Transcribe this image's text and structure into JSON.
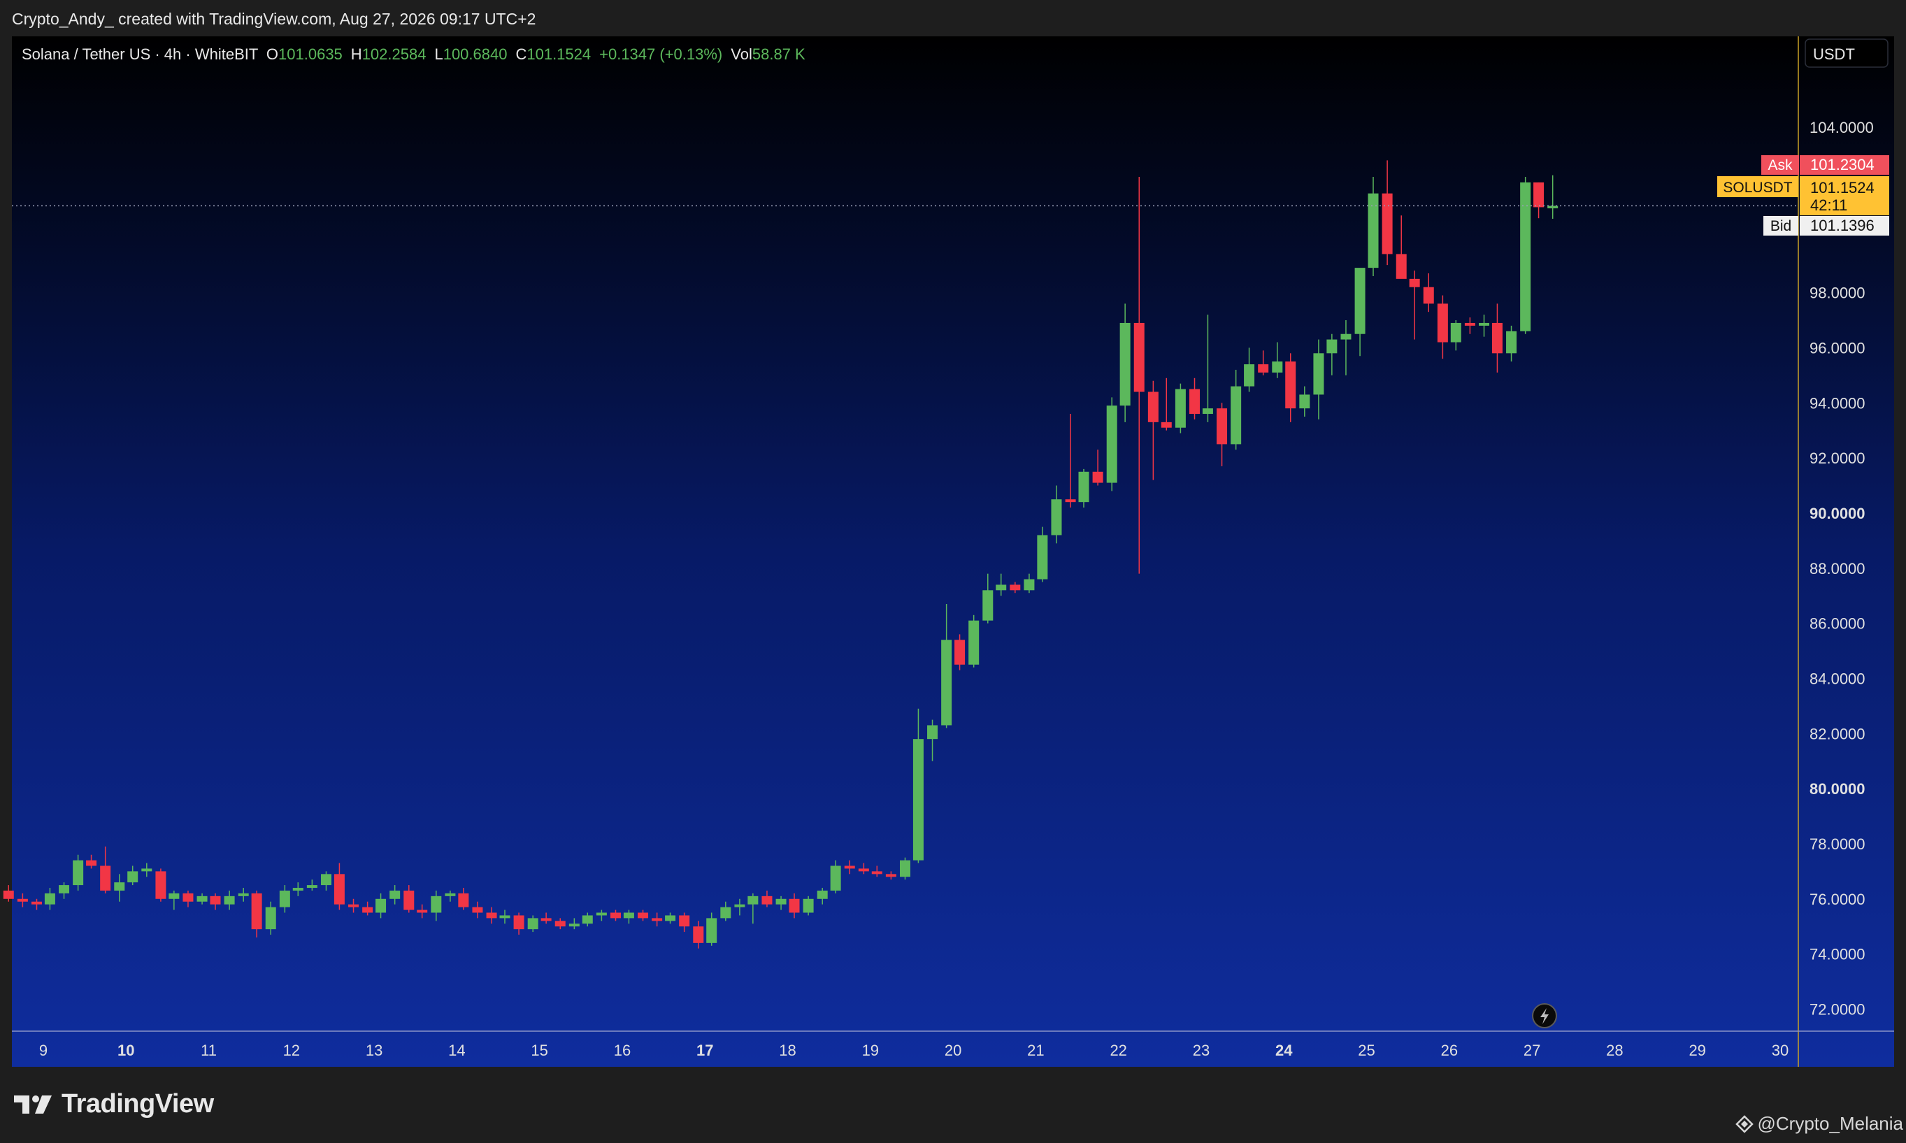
{
  "header": {
    "caption": "Crypto_Andy_ created with TradingView.com, Aug 27, 2026 09:17 UTC+2"
  },
  "legend": {
    "symbol_label": "Solana / Tether US · 4h · WhiteBIT",
    "open_label": "O",
    "open_value": "101.0635",
    "high_label": "H",
    "high_value": "102.2584",
    "low_label": "L",
    "low_value": "100.6840",
    "close_label": "C",
    "close_value": "101.1524",
    "change": "+0.1347 (+0.13%)",
    "vol_label": "Vol",
    "vol_value": "58.87 K"
  },
  "price_scale": {
    "currency": "USDT",
    "ask_label": "Ask",
    "ask_value": "101.2304",
    "symbol_tag": "SOLUSDT",
    "last_value": "101.1524",
    "countdown": "42:11",
    "bid_label": "Bid",
    "bid_value": "101.1396"
  },
  "footer": {
    "brand": "TradingView",
    "watermark": "@Crypto_Melania"
  },
  "colors": {
    "up": "#5cb85c",
    "down": "#f23645",
    "bg_top": "#000000",
    "bg_bottom": "#0f2d9e",
    "ask": "#f0505c",
    "last": "#ffc233",
    "bid": "#f0f0f0"
  },
  "icons": {
    "brand": "tradingview-logo-icon",
    "watermark": "diamond-icon",
    "flash": "lightning-icon"
  },
  "chart_data": {
    "type": "candlestick",
    "interval": "4h",
    "y_ticks": [
      72,
      74,
      76,
      78,
      80,
      82,
      84,
      86,
      88,
      90,
      92,
      94,
      96,
      98,
      100,
      102,
      104
    ],
    "y_tick_labels": [
      "72.0000",
      "74.0000",
      "76.0000",
      "78.0000",
      "80.0000",
      "82.0000",
      "84.0000",
      "86.0000",
      "88.0000",
      "90.0000",
      "92.0000",
      "94.0000",
      "96.0000",
      "98.0000",
      "",
      "",
      "104.0000"
    ],
    "ylim": [
      71.2,
      107.3
    ],
    "x_ticks": [
      9,
      10,
      11,
      12,
      13,
      14,
      15,
      16,
      17,
      18,
      19,
      20,
      21,
      22,
      23,
      24,
      25,
      26,
      27,
      28,
      29,
      30
    ],
    "x_tick_labels": [
      "9",
      "10",
      "11",
      "12",
      "13",
      "14",
      "15",
      "16",
      "17",
      "18",
      "19",
      "20",
      "21",
      "22",
      "23",
      "24",
      "25",
      "26",
      "27",
      "28",
      "29",
      "30"
    ],
    "x_bold_labels": [
      "10",
      "17",
      "24"
    ],
    "xlim": [
      8.62,
      30.22
    ],
    "last_price": 101.1524,
    "candles": [
      {
        "t": 8.58,
        "o": 76.3,
        "h": 76.5,
        "l": 75.9,
        "c": 76.0
      },
      {
        "t": 8.75,
        "o": 76.0,
        "h": 76.2,
        "l": 75.7,
        "c": 75.9
      },
      {
        "t": 8.92,
        "o": 75.9,
        "h": 76.0,
        "l": 75.6,
        "c": 75.8
      },
      {
        "t": 9.08,
        "o": 75.8,
        "h": 76.4,
        "l": 75.6,
        "c": 76.2
      },
      {
        "t": 9.25,
        "o": 76.2,
        "h": 76.6,
        "l": 76.0,
        "c": 76.5
      },
      {
        "t": 9.42,
        "o": 76.5,
        "h": 77.6,
        "l": 76.3,
        "c": 77.4
      },
      {
        "t": 9.58,
        "o": 77.4,
        "h": 77.6,
        "l": 77.1,
        "c": 77.2
      },
      {
        "t": 9.75,
        "o": 77.2,
        "h": 77.9,
        "l": 76.2,
        "c": 76.3
      },
      {
        "t": 9.92,
        "o": 76.3,
        "h": 76.9,
        "l": 75.9,
        "c": 76.6
      },
      {
        "t": 10.08,
        "o": 76.6,
        "h": 77.2,
        "l": 76.5,
        "c": 77.0
      },
      {
        "t": 10.25,
        "o": 77.0,
        "h": 77.3,
        "l": 76.8,
        "c": 77.1
      },
      {
        "t": 10.42,
        "o": 77.0,
        "h": 77.1,
        "l": 75.9,
        "c": 76.0
      },
      {
        "t": 10.58,
        "o": 76.0,
        "h": 76.3,
        "l": 75.6,
        "c": 76.2
      },
      {
        "t": 10.75,
        "o": 76.2,
        "h": 76.3,
        "l": 75.7,
        "c": 75.9
      },
      {
        "t": 10.92,
        "o": 75.9,
        "h": 76.2,
        "l": 75.8,
        "c": 76.1
      },
      {
        "t": 11.08,
        "o": 76.1,
        "h": 76.2,
        "l": 75.6,
        "c": 75.8
      },
      {
        "t": 11.25,
        "o": 75.8,
        "h": 76.3,
        "l": 75.6,
        "c": 76.1
      },
      {
        "t": 11.42,
        "o": 76.1,
        "h": 76.4,
        "l": 75.9,
        "c": 76.2
      },
      {
        "t": 11.58,
        "o": 76.2,
        "h": 76.3,
        "l": 74.6,
        "c": 74.9
      },
      {
        "t": 11.75,
        "o": 74.9,
        "h": 75.9,
        "l": 74.7,
        "c": 75.7
      },
      {
        "t": 11.92,
        "o": 75.7,
        "h": 76.5,
        "l": 75.5,
        "c": 76.3
      },
      {
        "t": 12.08,
        "o": 76.3,
        "h": 76.6,
        "l": 76.1,
        "c": 76.4
      },
      {
        "t": 12.25,
        "o": 76.4,
        "h": 76.7,
        "l": 76.3,
        "c": 76.5
      },
      {
        "t": 12.42,
        "o": 76.5,
        "h": 77.0,
        "l": 76.3,
        "c": 76.9
      },
      {
        "t": 12.58,
        "o": 76.9,
        "h": 77.3,
        "l": 75.6,
        "c": 75.8
      },
      {
        "t": 12.75,
        "o": 75.8,
        "h": 76.0,
        "l": 75.5,
        "c": 75.7
      },
      {
        "t": 12.92,
        "o": 75.7,
        "h": 75.9,
        "l": 75.4,
        "c": 75.5
      },
      {
        "t": 13.08,
        "o": 75.5,
        "h": 76.2,
        "l": 75.3,
        "c": 76.0
      },
      {
        "t": 13.25,
        "o": 76.0,
        "h": 76.5,
        "l": 75.8,
        "c": 76.3
      },
      {
        "t": 13.42,
        "o": 76.3,
        "h": 76.5,
        "l": 75.5,
        "c": 75.6
      },
      {
        "t": 13.58,
        "o": 75.6,
        "h": 75.8,
        "l": 75.3,
        "c": 75.5
      },
      {
        "t": 13.75,
        "o": 75.5,
        "h": 76.3,
        "l": 75.2,
        "c": 76.1
      },
      {
        "t": 13.92,
        "o": 76.1,
        "h": 76.3,
        "l": 75.9,
        "c": 76.2
      },
      {
        "t": 14.08,
        "o": 76.2,
        "h": 76.4,
        "l": 75.6,
        "c": 75.7
      },
      {
        "t": 14.25,
        "o": 75.7,
        "h": 75.9,
        "l": 75.3,
        "c": 75.5
      },
      {
        "t": 14.42,
        "o": 75.5,
        "h": 75.7,
        "l": 75.1,
        "c": 75.3
      },
      {
        "t": 14.58,
        "o": 75.3,
        "h": 75.6,
        "l": 75.1,
        "c": 75.4
      },
      {
        "t": 14.75,
        "o": 75.4,
        "h": 75.5,
        "l": 74.7,
        "c": 74.9
      },
      {
        "t": 14.92,
        "o": 74.9,
        "h": 75.4,
        "l": 74.8,
        "c": 75.3
      },
      {
        "t": 15.08,
        "o": 75.3,
        "h": 75.5,
        "l": 75.1,
        "c": 75.2
      },
      {
        "t": 15.25,
        "o": 75.2,
        "h": 75.3,
        "l": 74.9,
        "c": 75.0
      },
      {
        "t": 15.42,
        "o": 75.0,
        "h": 75.3,
        "l": 74.9,
        "c": 75.1
      },
      {
        "t": 15.58,
        "o": 75.1,
        "h": 75.5,
        "l": 75.0,
        "c": 75.4
      },
      {
        "t": 15.75,
        "o": 75.4,
        "h": 75.6,
        "l": 75.2,
        "c": 75.5
      },
      {
        "t": 15.92,
        "o": 75.5,
        "h": 75.6,
        "l": 75.2,
        "c": 75.3
      },
      {
        "t": 16.08,
        "o": 75.3,
        "h": 75.6,
        "l": 75.1,
        "c": 75.5
      },
      {
        "t": 16.25,
        "o": 75.5,
        "h": 75.6,
        "l": 75.2,
        "c": 75.3
      },
      {
        "t": 16.42,
        "o": 75.3,
        "h": 75.5,
        "l": 75.0,
        "c": 75.2
      },
      {
        "t": 16.58,
        "o": 75.2,
        "h": 75.5,
        "l": 75.1,
        "c": 75.4
      },
      {
        "t": 16.75,
        "o": 75.4,
        "h": 75.5,
        "l": 74.8,
        "c": 75.0
      },
      {
        "t": 16.92,
        "o": 75.0,
        "h": 75.2,
        "l": 74.2,
        "c": 74.4
      },
      {
        "t": 17.08,
        "o": 74.4,
        "h": 75.5,
        "l": 74.3,
        "c": 75.3
      },
      {
        "t": 17.25,
        "o": 75.3,
        "h": 75.9,
        "l": 75.2,
        "c": 75.7
      },
      {
        "t": 17.42,
        "o": 75.7,
        "h": 76.0,
        "l": 75.4,
        "c": 75.8
      },
      {
        "t": 17.58,
        "o": 75.8,
        "h": 76.2,
        "l": 75.1,
        "c": 76.1
      },
      {
        "t": 17.75,
        "o": 76.1,
        "h": 76.3,
        "l": 75.7,
        "c": 75.8
      },
      {
        "t": 17.92,
        "o": 75.8,
        "h": 76.1,
        "l": 75.6,
        "c": 76.0
      },
      {
        "t": 18.08,
        "o": 76.0,
        "h": 76.2,
        "l": 75.3,
        "c": 75.5
      },
      {
        "t": 18.25,
        "o": 75.5,
        "h": 76.1,
        "l": 75.4,
        "c": 76.0
      },
      {
        "t": 18.42,
        "o": 76.0,
        "h": 76.4,
        "l": 75.8,
        "c": 76.3
      },
      {
        "t": 18.58,
        "o": 76.3,
        "h": 77.4,
        "l": 76.2,
        "c": 77.2
      },
      {
        "t": 18.75,
        "o": 77.2,
        "h": 77.4,
        "l": 76.9,
        "c": 77.1
      },
      {
        "t": 18.92,
        "o": 77.1,
        "h": 77.3,
        "l": 76.9,
        "c": 77.0
      },
      {
        "t": 19.08,
        "o": 77.0,
        "h": 77.2,
        "l": 76.8,
        "c": 76.9
      },
      {
        "t": 19.25,
        "o": 76.9,
        "h": 77.0,
        "l": 76.7,
        "c": 76.8
      },
      {
        "t": 19.42,
        "o": 76.8,
        "h": 77.5,
        "l": 76.7,
        "c": 77.4
      },
      {
        "t": 19.58,
        "o": 77.4,
        "h": 82.9,
        "l": 77.3,
        "c": 81.8
      },
      {
        "t": 19.75,
        "o": 81.8,
        "h": 82.5,
        "l": 81.0,
        "c": 82.3
      },
      {
        "t": 19.92,
        "o": 82.3,
        "h": 86.7,
        "l": 82.2,
        "c": 85.4
      },
      {
        "t": 20.08,
        "o": 85.4,
        "h": 85.6,
        "l": 84.3,
        "c": 84.5
      },
      {
        "t": 20.25,
        "o": 84.5,
        "h": 86.3,
        "l": 84.4,
        "c": 86.1
      },
      {
        "t": 20.42,
        "o": 86.1,
        "h": 87.8,
        "l": 86.0,
        "c": 87.2
      },
      {
        "t": 20.58,
        "o": 87.2,
        "h": 87.8,
        "l": 87.0,
        "c": 87.4
      },
      {
        "t": 20.75,
        "o": 87.4,
        "h": 87.5,
        "l": 87.1,
        "c": 87.2
      },
      {
        "t": 20.92,
        "o": 87.2,
        "h": 87.8,
        "l": 87.1,
        "c": 87.6
      },
      {
        "t": 21.08,
        "o": 87.6,
        "h": 89.5,
        "l": 87.5,
        "c": 89.2
      },
      {
        "t": 21.25,
        "o": 89.2,
        "h": 91.0,
        "l": 88.9,
        "c": 90.5
      },
      {
        "t": 21.42,
        "o": 90.5,
        "h": 93.6,
        "l": 90.2,
        "c": 90.4
      },
      {
        "t": 21.58,
        "o": 90.4,
        "h": 91.6,
        "l": 90.2,
        "c": 91.5
      },
      {
        "t": 21.75,
        "o": 91.5,
        "h": 92.3,
        "l": 91.0,
        "c": 91.1
      },
      {
        "t": 21.92,
        "o": 91.1,
        "h": 94.2,
        "l": 90.8,
        "c": 93.9
      },
      {
        "t": 22.08,
        "o": 93.9,
        "h": 97.6,
        "l": 93.3,
        "c": 96.9
      },
      {
        "t": 22.25,
        "o": 96.9,
        "h": 102.2,
        "l": 87.8,
        "c": 94.4
      },
      {
        "t": 22.42,
        "o": 94.4,
        "h": 94.8,
        "l": 91.2,
        "c": 93.3
      },
      {
        "t": 22.58,
        "o": 93.3,
        "h": 94.9,
        "l": 93.0,
        "c": 93.1
      },
      {
        "t": 22.75,
        "o": 93.1,
        "h": 94.7,
        "l": 92.9,
        "c": 94.5
      },
      {
        "t": 22.92,
        "o": 94.5,
        "h": 94.9,
        "l": 93.4,
        "c": 93.6
      },
      {
        "t": 23.08,
        "o": 93.6,
        "h": 97.2,
        "l": 93.3,
        "c": 93.8
      },
      {
        "t": 23.25,
        "o": 93.8,
        "h": 94.0,
        "l": 91.7,
        "c": 92.5
      },
      {
        "t": 23.42,
        "o": 92.5,
        "h": 95.2,
        "l": 92.3,
        "c": 94.6
      },
      {
        "t": 23.58,
        "o": 94.6,
        "h": 96.0,
        "l": 94.4,
        "c": 95.4
      },
      {
        "t": 23.75,
        "o": 95.4,
        "h": 95.9,
        "l": 95.0,
        "c": 95.1
      },
      {
        "t": 23.92,
        "o": 95.1,
        "h": 96.2,
        "l": 94.9,
        "c": 95.5
      },
      {
        "t": 24.08,
        "o": 95.5,
        "h": 95.8,
        "l": 93.3,
        "c": 93.8
      },
      {
        "t": 24.25,
        "o": 93.8,
        "h": 94.6,
        "l": 93.5,
        "c": 94.3
      },
      {
        "t": 24.42,
        "o": 94.3,
        "h": 96.3,
        "l": 93.4,
        "c": 95.8
      },
      {
        "t": 24.58,
        "o": 95.8,
        "h": 96.5,
        "l": 95.0,
        "c": 96.3
      },
      {
        "t": 24.75,
        "o": 96.3,
        "h": 97.0,
        "l": 95.0,
        "c": 96.5
      },
      {
        "t": 24.92,
        "o": 96.5,
        "h": 97.9,
        "l": 95.7,
        "c": 98.9
      },
      {
        "t": 25.08,
        "o": 98.9,
        "h": 102.2,
        "l": 98.6,
        "c": 101.6
      },
      {
        "t": 25.25,
        "o": 101.6,
        "h": 102.8,
        "l": 99.0,
        "c": 99.4
      },
      {
        "t": 25.42,
        "o": 99.4,
        "h": 100.8,
        "l": 98.6,
        "c": 98.5
      },
      {
        "t": 25.58,
        "o": 98.5,
        "h": 98.8,
        "l": 96.3,
        "c": 98.2
      },
      {
        "t": 25.75,
        "o": 98.2,
        "h": 98.7,
        "l": 97.3,
        "c": 97.6
      },
      {
        "t": 25.92,
        "o": 97.6,
        "h": 97.9,
        "l": 95.6,
        "c": 96.2
      },
      {
        "t": 26.08,
        "o": 96.2,
        "h": 97.0,
        "l": 95.9,
        "c": 96.9
      },
      {
        "t": 26.25,
        "o": 96.9,
        "h": 97.1,
        "l": 96.5,
        "c": 96.8
      },
      {
        "t": 26.42,
        "o": 96.8,
        "h": 97.2,
        "l": 96.4,
        "c": 96.9
      },
      {
        "t": 26.58,
        "o": 96.9,
        "h": 97.6,
        "l": 95.1,
        "c": 95.8
      },
      {
        "t": 26.75,
        "o": 95.8,
        "h": 96.8,
        "l": 95.5,
        "c": 96.6
      },
      {
        "t": 26.92,
        "o": 96.6,
        "h": 102.2,
        "l": 96.5,
        "c": 102.0
      },
      {
        "t": 27.08,
        "o": 102.0,
        "h": 102.0,
        "l": 100.7,
        "c": 101.1
      },
      {
        "t": 27.25,
        "o": 101.06,
        "h": 102.26,
        "l": 100.68,
        "c": 101.15
      }
    ]
  }
}
